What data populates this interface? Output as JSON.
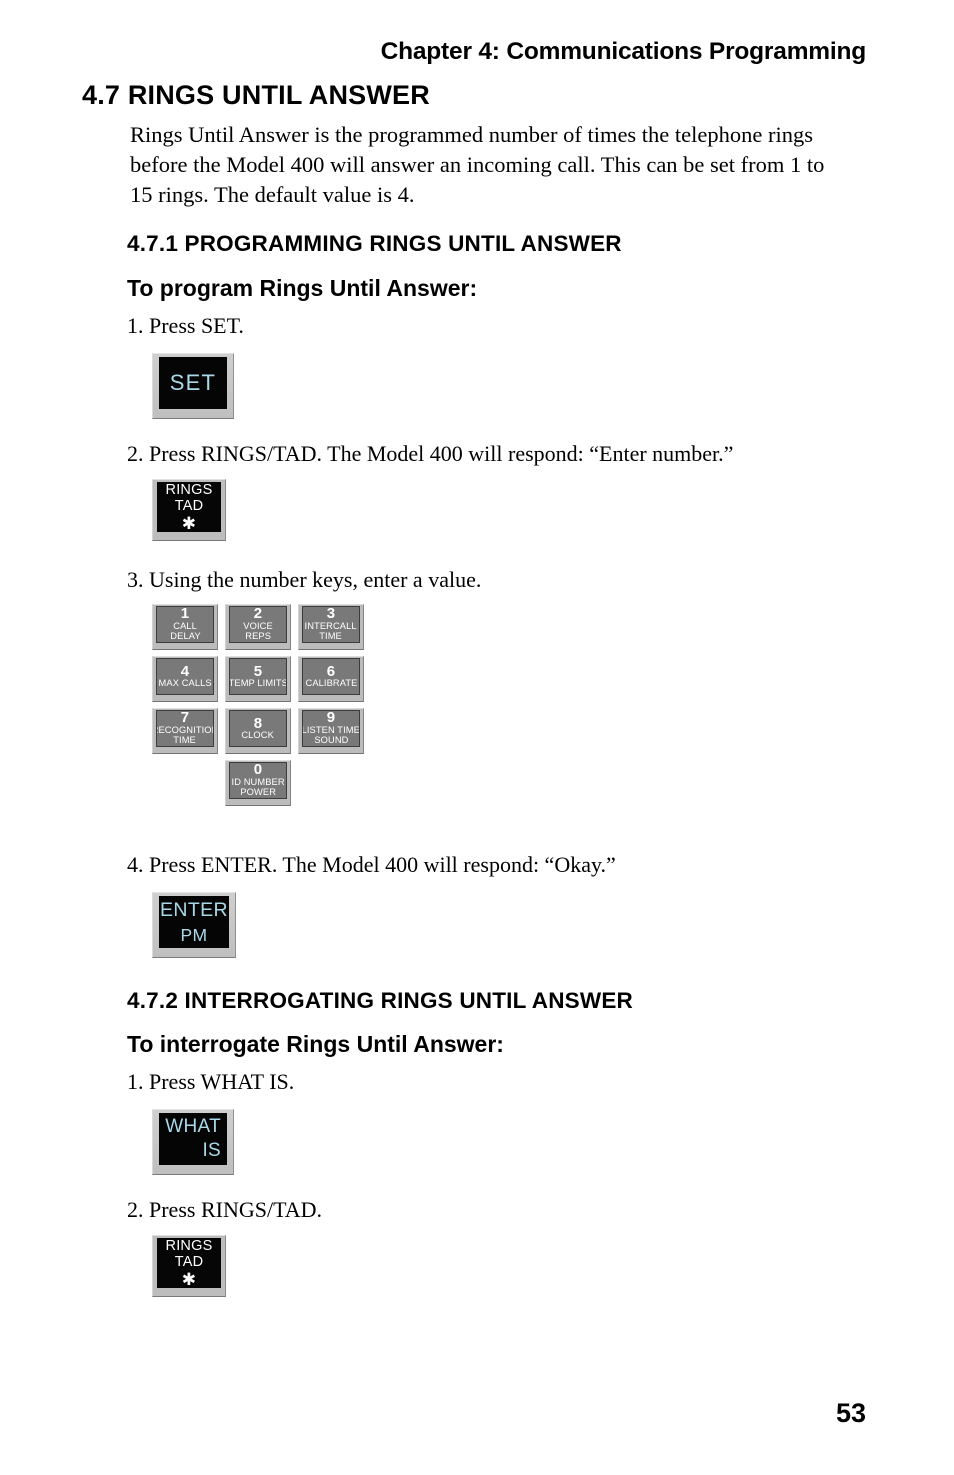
{
  "header": {
    "chapter": "Chapter 4: Communications Programming"
  },
  "page_number": "53",
  "sections": {
    "main_heading": "4.7 RINGS UNTIL ANSWER",
    "intro_paragraph": "Rings Until Answer is the programmed number of times the telephone rings before the Model 400 will answer an incoming call. This can be set from 1 to 15 rings. The default value is 4.",
    "sub1": {
      "heading": "4.7.1 PROGRAMMING RINGS UNTIL ANSWER",
      "lead": "To program Rings Until Answer:",
      "steps": [
        "1. Press SET.",
        "2. Press RINGS/TAD. The Model 400 will respond: “Enter number.”",
        "3. Using the number keys, enter a value.",
        "4. Press ENTER. The Model 400 will respond: “Okay.”"
      ]
    },
    "sub2": {
      "heading": "4.7.2 INTERROGATING RINGS UNTIL ANSWER",
      "lead": "To interrogate Rings Until Answer:",
      "steps": [
        "1. Press WHAT IS.",
        "2. Press RINGS/TAD."
      ]
    }
  },
  "keys": {
    "set": {
      "line1": "SET"
    },
    "rings_tad_1": {
      "line1": "RINGS",
      "line2": "TAD",
      "line3": "✱"
    },
    "rings_tad_2": {
      "line1": "RINGS",
      "line2": "TAD",
      "line3": "✱"
    },
    "enter": {
      "line1": "ENTER",
      "line2": "PM"
    },
    "what_is": {
      "line1": "WHAT",
      "line2": "IS"
    }
  },
  "numpad": {
    "rows": [
      [
        {
          "digit": "1",
          "sub1": "CALL",
          "sub2": "DELAY"
        },
        {
          "digit": "2",
          "sub1": "VOICE",
          "sub2": "REPS"
        },
        {
          "digit": "3",
          "sub1": "INTERCALL",
          "sub2": "TIME"
        }
      ],
      [
        {
          "digit": "4",
          "sub1": "MAX CALLS",
          "sub2": ""
        },
        {
          "digit": "5",
          "sub1": "TEMP LIMITS",
          "sub2": ""
        },
        {
          "digit": "6",
          "sub1": "CALIBRATE",
          "sub2": ""
        }
      ],
      [
        {
          "digit": "7",
          "sub1": "RECOGNITION",
          "sub2": "TIME"
        },
        {
          "digit": "8",
          "sub1": "CLOCK",
          "sub2": ""
        },
        {
          "digit": "9",
          "sub1": "LISTEN TIME",
          "sub2": "SOUND"
        }
      ],
      [
        {
          "digit": "0",
          "sub1": "ID NUMBER",
          "sub2": "POWER"
        }
      ]
    ]
  },
  "colors": {
    "key_face_black": "#050505",
    "key_text_blue": "#a9d9e9",
    "key_face_gray": "#797979",
    "key_bevel": "#bdbdbd",
    "text": "#000000"
  }
}
